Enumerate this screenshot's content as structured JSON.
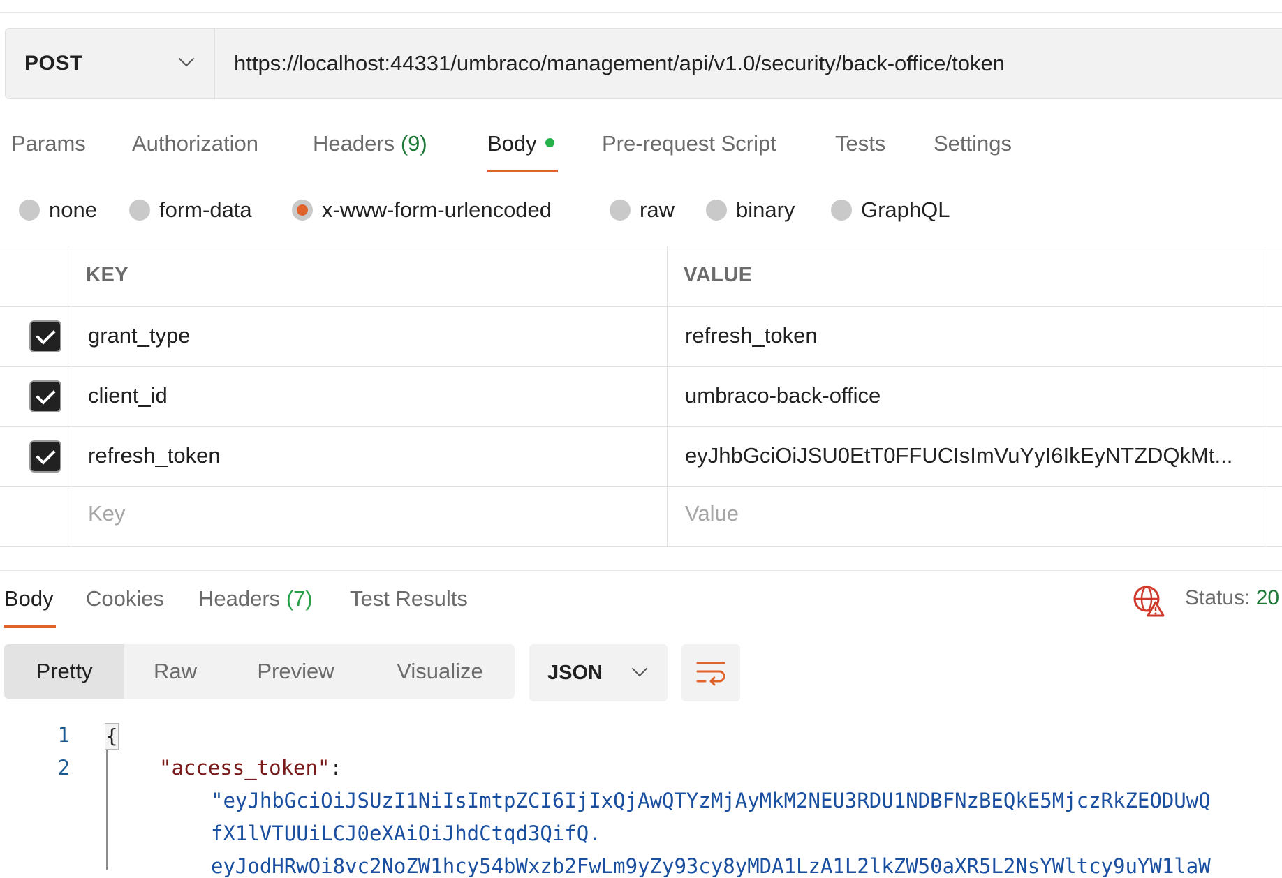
{
  "request": {
    "method": "POST",
    "url": "https://localhost:44331/umbraco/management/api/v1.0/security/back-office/token"
  },
  "request_tabs": [
    {
      "label": "Params"
    },
    {
      "label": "Authorization"
    },
    {
      "label": "Headers",
      "count": "(9)"
    },
    {
      "label": "Body",
      "active": true
    },
    {
      "label": "Pre-request Script"
    },
    {
      "label": "Tests"
    },
    {
      "label": "Settings"
    }
  ],
  "body_types": [
    {
      "label": "none",
      "checked": false
    },
    {
      "label": "form-data",
      "checked": false
    },
    {
      "label": "x-www-form-urlencoded",
      "checked": true
    },
    {
      "label": "raw",
      "checked": false
    },
    {
      "label": "binary",
      "checked": false
    },
    {
      "label": "GraphQL",
      "checked": false
    }
  ],
  "kv_table": {
    "headers": {
      "key": "KEY",
      "value": "VALUE"
    },
    "rows": [
      {
        "checked": true,
        "key": "grant_type",
        "value": "refresh_token"
      },
      {
        "checked": true,
        "key": "client_id",
        "value": "umbraco-back-office"
      },
      {
        "checked": true,
        "key": "refresh_token",
        "value": "eyJhbGciOiJSU0EtT0FFUCIsImVuYyI6IkEyNTZDQkMt..."
      }
    ],
    "placeholder": {
      "key": "Key",
      "value": "Value"
    }
  },
  "response_tabs": [
    {
      "label": "Body",
      "active": true
    },
    {
      "label": "Cookies"
    },
    {
      "label": "Headers",
      "count": "(7)"
    },
    {
      "label": "Test Results"
    }
  ],
  "status": {
    "label": "Status:",
    "value": "20"
  },
  "view_modes": [
    {
      "label": "Pretty",
      "active": true
    },
    {
      "label": "Raw"
    },
    {
      "label": "Preview"
    },
    {
      "label": "Visualize"
    }
  ],
  "format": "JSON",
  "code": {
    "line_numbers": [
      "1",
      "2"
    ],
    "open_brace": "{",
    "key": "\"access_token\"",
    "colon": ":",
    "value_lines": [
      "\"eyJhbGciOiJSUzI1NiIsImtpZCI6IjIxQjAwQTYzMjAyMkM2NEU3RDU1NDBFNzBEQkE5MjczRkZEODUwQ",
      "fX1lVTUUiLCJ0eXAiOiJhdCtqd3QifQ.",
      "eyJodHRwOi8vc2NoZW1hcy54bWxzb2FwLm9yZy93cy8yMDA1LzA1L2lkZW50aXR5L2NsYWltcy9uYW1laW"
    ]
  },
  "colors": {
    "accent": "#e0632c",
    "success": "#26b14b",
    "status_icon": "#d0382b"
  }
}
